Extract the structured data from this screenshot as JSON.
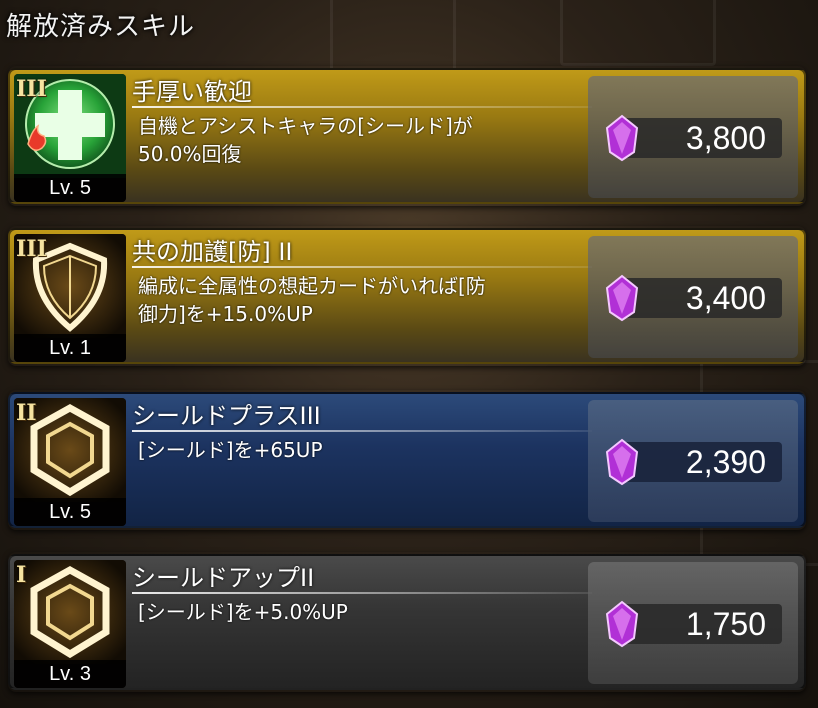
{
  "header": {
    "title": "解放済みスキル"
  },
  "skills": [
    {
      "tier": "III",
      "name": "手厚い歓迎",
      "description": "自機とアシストキャラの[シールド]が\n50.0%回復",
      "level": "Lv. 5",
      "cost": "3,800",
      "icon": "heal-plus-icon"
    },
    {
      "tier": "III",
      "name": "共の加護[防] II",
      "description": "編成に全属性の想起カードがいれば[防\n御力]を+15.0%UP",
      "level": "Lv. 1",
      "cost": "3,400",
      "icon": "shield-icon"
    },
    {
      "tier": "II",
      "name": "シールドプラスIII",
      "description": "[シールド]を+65UP",
      "level": "Lv. 5",
      "cost": "2,390",
      "icon": "hexagon-shield-icon"
    },
    {
      "tier": "I",
      "name": "シールドアップII",
      "description": "[シールド]を+5.0%UP",
      "level": "Lv. 3",
      "cost": "1,750",
      "icon": "hexagon-shield-icon"
    }
  ],
  "colors": {
    "gold_tier": "#c09a18",
    "blue_tier": "#2c4a7a",
    "gray_tier": "#4a4a4a",
    "gem": "#c040e0"
  }
}
